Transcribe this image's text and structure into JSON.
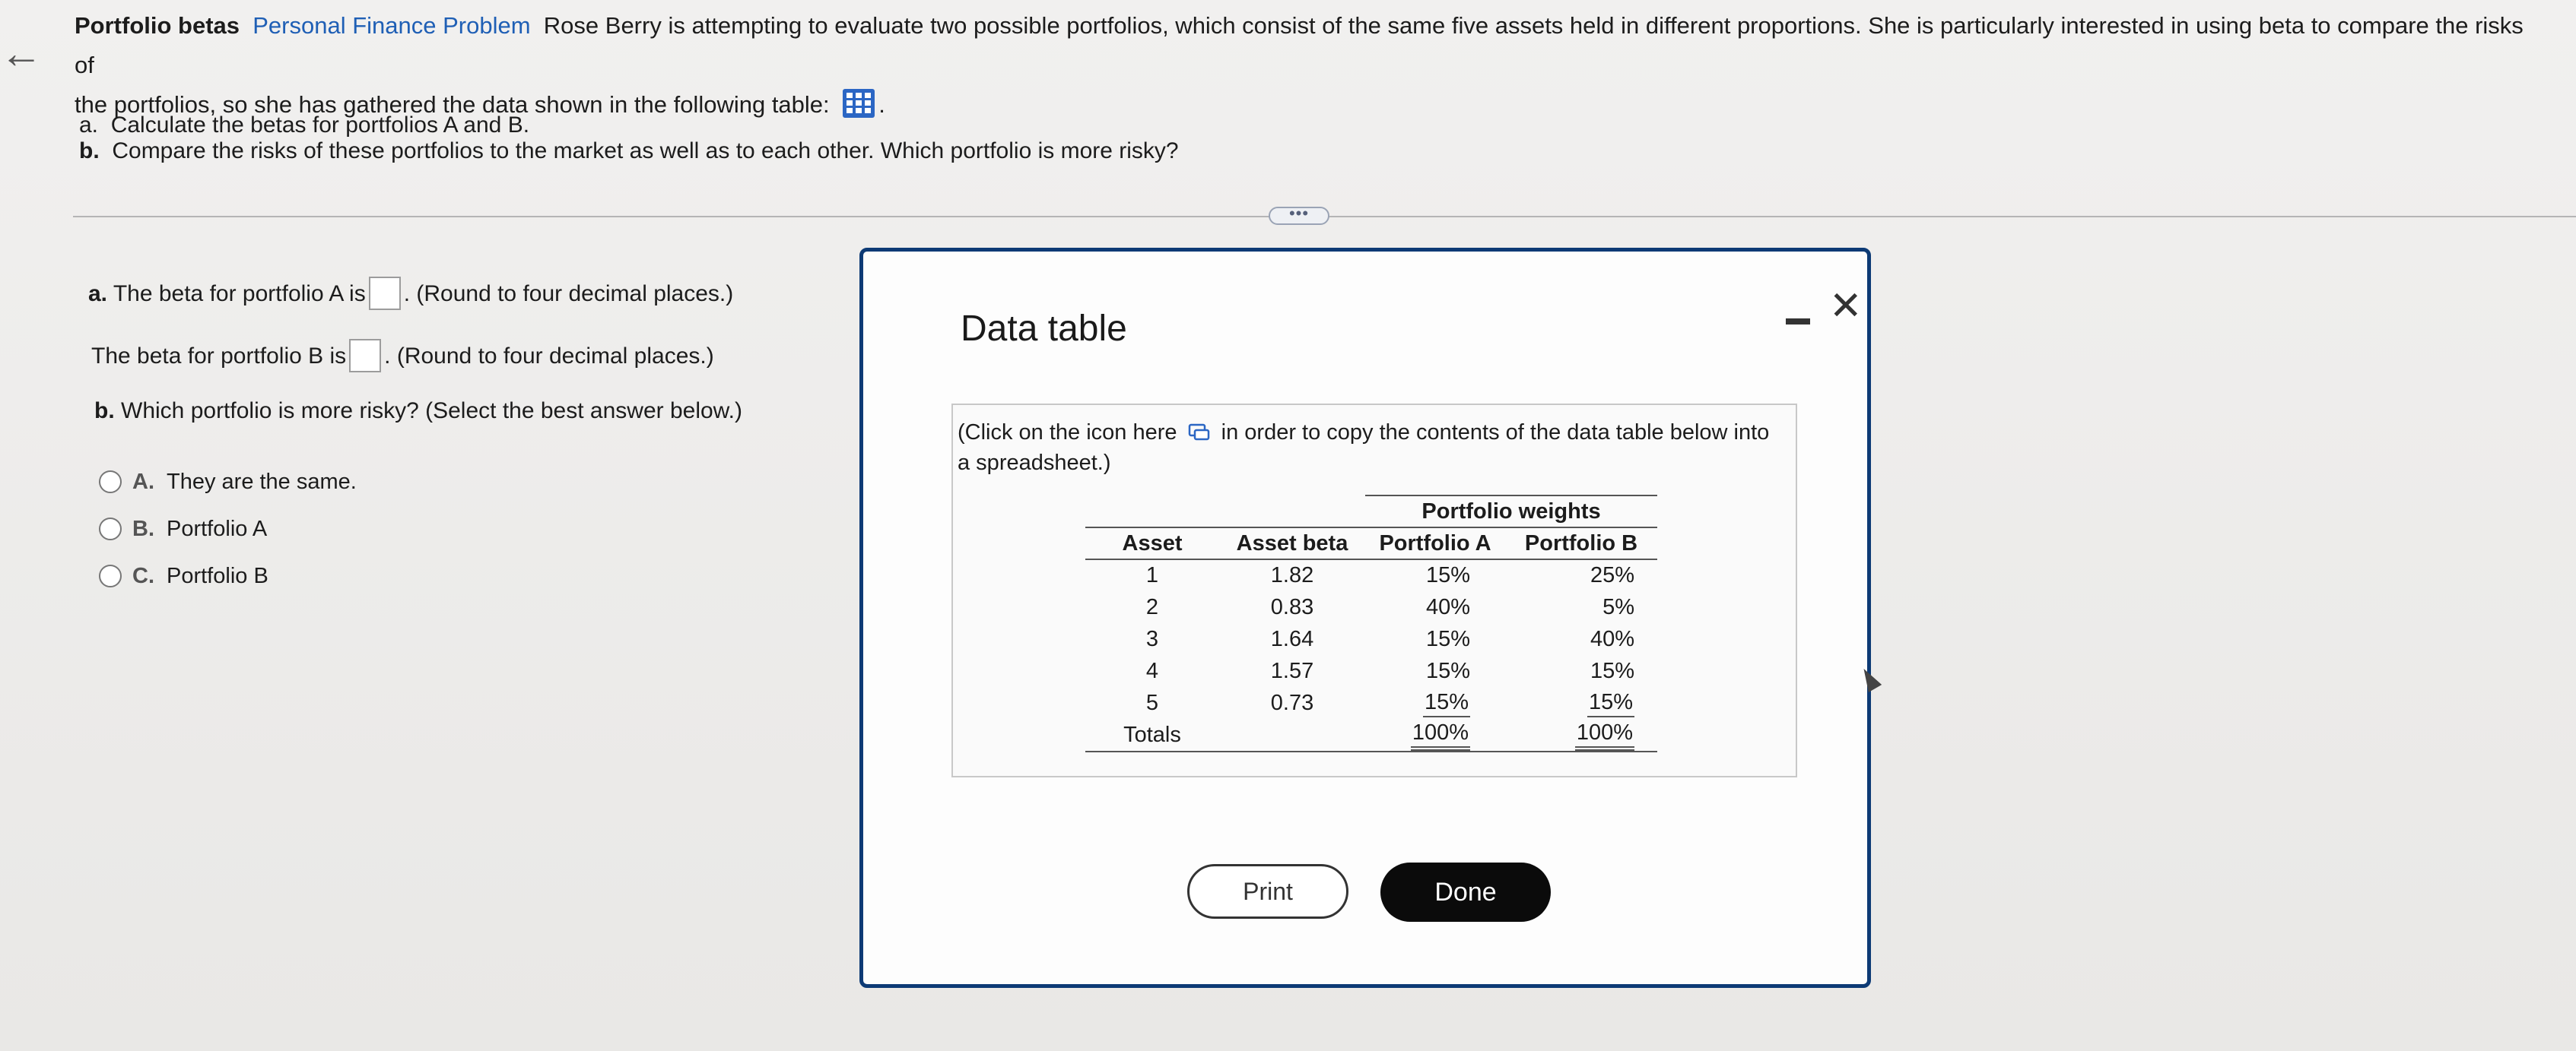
{
  "problem": {
    "title": "Portfolio betas",
    "tag": "Personal Finance Problem",
    "text_line1": "Rose Berry is attempting to evaluate two possible portfolios, which consist of the same five assets held in different proportions.  She is particularly interested in using beta to compare the risks of",
    "text_line2": "the portfolios, so she has gathered the data shown in the following table:",
    "part_a_label": "a.",
    "part_a": "Calculate the betas for portfolios A and B.",
    "part_b_label": "b.",
    "part_b": "Compare the risks of these portfolios to the market as well as to each other.  Which portfolio is more risky?"
  },
  "answers": {
    "a_label": "a.",
    "a_prefix": "The beta for portfolio A is",
    "a_suffix": ". (Round to four decimal places.)",
    "b_prefix": "The beta for portfolio B is",
    "b_suffix": ". (Round to four decimal places.)",
    "q_label": "b.",
    "q_text": "Which portfolio is more risky?  (Select the best answer below.)",
    "options": [
      {
        "letter": "A.",
        "text": "They are the same."
      },
      {
        "letter": "B.",
        "text": "Portfolio A"
      },
      {
        "letter": "C.",
        "text": "Portfolio B"
      }
    ]
  },
  "dialog": {
    "title": "Data table",
    "note_prefix": "(Click on the icon here",
    "note_suffix": "in order to copy the contents of the data table below into a spreadsheet.)",
    "table": {
      "group_header": "Portfolio weights",
      "headers": [
        "Asset",
        "Asset beta",
        "Portfolio A",
        "Portfolio B"
      ],
      "rows": [
        [
          "1",
          "1.82",
          "15%",
          "25%"
        ],
        [
          "2",
          "0.83",
          "40%",
          "5%"
        ],
        [
          "3",
          "1.64",
          "15%",
          "40%"
        ],
        [
          "4",
          "1.57",
          "15%",
          "15%"
        ],
        [
          "5",
          "0.73",
          "15%",
          "15%"
        ]
      ],
      "totals": [
        "Totals",
        "",
        "100%",
        "100%"
      ]
    },
    "print_label": "Print",
    "done_label": "Done"
  }
}
